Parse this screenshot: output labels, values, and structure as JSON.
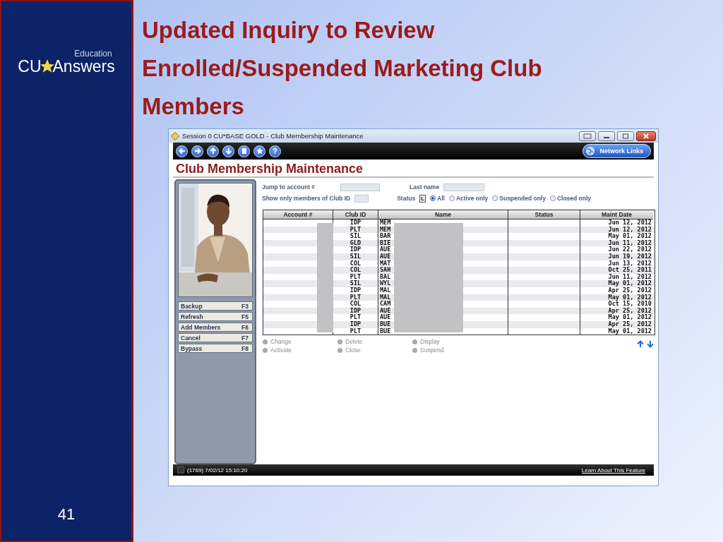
{
  "slide": {
    "logo": {
      "top": "Education",
      "left": "CU",
      "right": "Answers"
    },
    "title": "Updated Inquiry to Review Enrolled/Suspended Marketing Club Members",
    "page_number": "41"
  },
  "window": {
    "title": "Session 0 CU*BASE GOLD - Club Membership Maintenance"
  },
  "toolbar": {
    "buttons": [
      {
        "kind": "back"
      },
      {
        "kind": "forward"
      },
      {
        "kind": "up"
      },
      {
        "kind": "down"
      },
      {
        "kind": "document"
      },
      {
        "kind": "star"
      },
      {
        "kind": "help",
        "glyph": "?"
      }
    ],
    "network_links": "Network Links"
  },
  "heading": "Club Membership Maintenance",
  "fkeys": [
    {
      "label": "Backup",
      "key": "F3"
    },
    {
      "label": "Refresh",
      "key": "F5"
    },
    {
      "label": "Add Members",
      "key": "F6"
    },
    {
      "label": "Cancel",
      "key": "F7"
    },
    {
      "label": "Bypass",
      "key": "F8"
    }
  ],
  "filters": {
    "jump_label": "Jump to account #",
    "last_name_label": "Last name",
    "club_label": "Show only members  of Club ID",
    "status_label": "Status",
    "status_code": "L",
    "radios": [
      {
        "label": "All",
        "selected": true
      },
      {
        "label": "Active only",
        "selected": false
      },
      {
        "label": "Suspended only",
        "selected": false
      },
      {
        "label": "Closed only",
        "selected": false
      }
    ]
  },
  "table": {
    "columns": [
      "Account #",
      "Club ID",
      "Name",
      "Status",
      "Maint Date"
    ],
    "rows": [
      {
        "club_id": "IDP",
        "name": "MEM",
        "maint_date": "Jun 12, 2012"
      },
      {
        "club_id": "PLT",
        "name": "MEM",
        "maint_date": "Jun 12, 2012"
      },
      {
        "club_id": "SIL",
        "name": "BAR",
        "maint_date": "May 01, 2012"
      },
      {
        "club_id": "GLD",
        "name": "BIE",
        "maint_date": "Jun 11, 2012"
      },
      {
        "club_id": "IDP",
        "name": "AUE",
        "maint_date": "Jun 22, 2012"
      },
      {
        "club_id": "SIL",
        "name": "AUE",
        "maint_date": "Jun 19, 2012"
      },
      {
        "club_id": "COL",
        "name": "MAT",
        "maint_date": "Jun 13, 2012"
      },
      {
        "club_id": "COL",
        "name": "SAH",
        "maint_date": "Oct 25, 2011"
      },
      {
        "club_id": "PLT",
        "name": "BAL",
        "maint_date": "Jun 11, 2012"
      },
      {
        "club_id": "SIL",
        "name": "WYL",
        "maint_date": "May 01, 2012"
      },
      {
        "club_id": "IDP",
        "name": "MAL",
        "maint_date": "Apr 25, 2012"
      },
      {
        "club_id": "PLT",
        "name": "MAL",
        "maint_date": "May 01, 2012"
      },
      {
        "club_id": "COL",
        "name": "CAM",
        "maint_date": "Oct 15, 2010"
      },
      {
        "club_id": "IDP",
        "name": "AUE",
        "maint_date": "Apr 25, 2012"
      },
      {
        "club_id": "PLT",
        "name": "AUE",
        "maint_date": "May 01, 2012"
      },
      {
        "club_id": "IDP",
        "name": "BUE",
        "maint_date": "Apr 25, 2012"
      },
      {
        "club_id": "PLT",
        "name": "BUE",
        "maint_date": "May 01, 2012"
      }
    ]
  },
  "actions": [
    {
      "label": "Change",
      "disabled": true
    },
    {
      "label": "Delete",
      "disabled": true
    },
    {
      "label": "Display",
      "disabled": true
    },
    {
      "label": "Activate",
      "disabled": true
    },
    {
      "label": "Close",
      "disabled": true
    },
    {
      "label": "Suspend",
      "disabled": true
    }
  ],
  "status_bar": {
    "session": "(1769) 7/02/12 15:10:20",
    "link": "Learn About This Feature"
  }
}
